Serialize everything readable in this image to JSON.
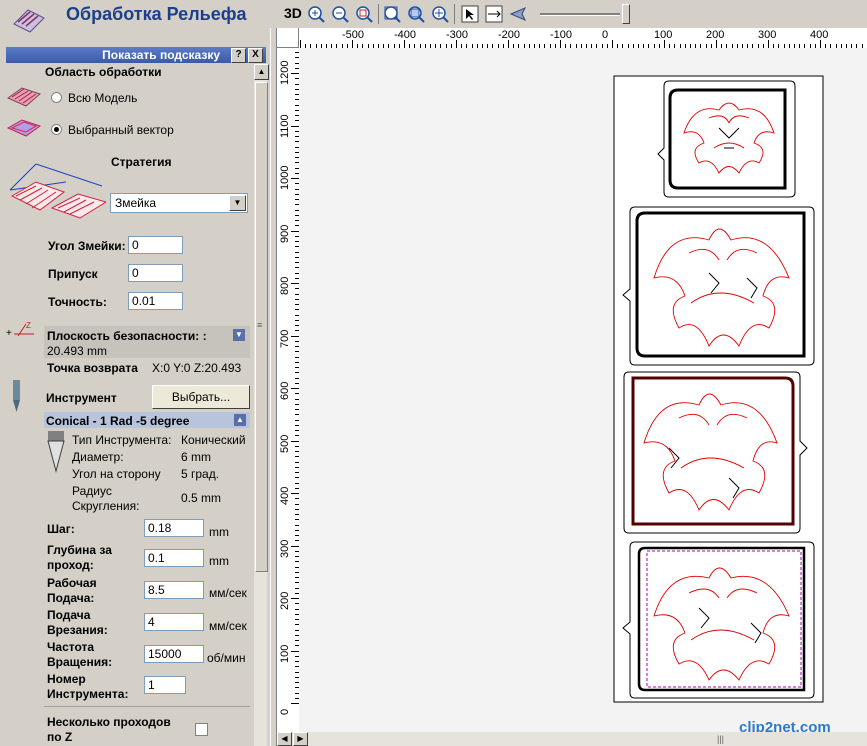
{
  "panel": {
    "title": "Обработка Рельефа",
    "hint_bar": {
      "label": "Показать подсказку",
      "help": "?",
      "close": "X"
    },
    "area": {
      "heading": "Область обработки",
      "options": [
        {
          "label": "Всю Модель",
          "selected": false
        },
        {
          "label": "Выбранный вектор",
          "selected": true
        }
      ]
    },
    "strategy": {
      "heading": "Стратегия",
      "selected": "Змейка"
    },
    "params": [
      {
        "label": "Угол Змейки:",
        "value": "0"
      },
      {
        "label": "Припуск",
        "value": "0"
      },
      {
        "label": "Точность:",
        "value": "0.01"
      }
    ],
    "safe_plane": {
      "label": "Плоскость безопасности: :",
      "value": "20.493 mm"
    },
    "return_point": {
      "label": "Точка возврата",
      "value": "X:0 Y:0 Z:20.493"
    },
    "tool": {
      "heading": "Инструмент",
      "select_button": "Выбрать...",
      "name": "Conical - 1 Rad -5 degree",
      "props": [
        {
          "label": "Тип Инструмента:",
          "value": "Конический"
        },
        {
          "label": "Диаметр:",
          "value": "6 mm"
        },
        {
          "label": "Угол на сторону",
          "value": "5 град."
        },
        {
          "label": "Радиус Скругления:",
          "value": "0.5 mm"
        }
      ]
    },
    "cut_params": [
      {
        "label": "Шаг:",
        "value": "0.18",
        "unit": "mm"
      },
      {
        "label": "Глубина за проход:",
        "value": "0.1",
        "unit": "mm"
      },
      {
        "label": "Рабочая Подача:",
        "value": "8.5",
        "unit": "мм/сек"
      },
      {
        "label": "Подача Врезания:",
        "value": "4",
        "unit": "мм/сек"
      },
      {
        "label": "Частота Вращения:",
        "value": "15000",
        "unit": "об/мин"
      },
      {
        "label": "Номер Инструмента:",
        "value": "1",
        "unit": ""
      }
    ],
    "multi_pass": {
      "label": "Несколько проходов по Z",
      "checked": false
    }
  },
  "toolbar": {
    "label_3d": "3D"
  },
  "ruler": {
    "x_ticks": [
      "-500",
      "-400",
      "-300",
      "-200",
      "-100",
      "0",
      "100",
      "200",
      "300",
      "400"
    ],
    "y_ticks": [
      "1200",
      "1100",
      "1000",
      "900",
      "800",
      "700",
      "600",
      "500",
      "400",
      "300",
      "200",
      "100",
      "0"
    ]
  },
  "watermark": "clip2net.com"
}
